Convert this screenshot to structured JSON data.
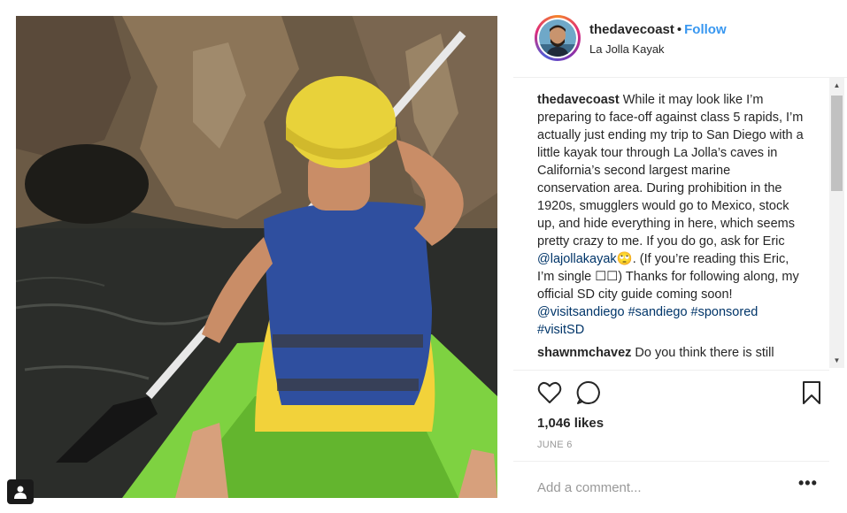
{
  "post": {
    "username": "thedavecoast",
    "separator": "•",
    "follow_label": "Follow",
    "location": "La Jolla Kayak"
  },
  "caption": {
    "username": "thedavecoast",
    "text_part1": "While it may look like I’m preparing to face-off against class 5 rapids, I’m actually just ending my trip to San Diego with a little kayak tour through La Jolla’s caves in California’s second largest marine conservation area. During prohibition in the 1920s, smugglers would go to Mexico, stock up, and hide everything in here, which seems pretty crazy to me. If you do go, ask for Eric",
    "mention_1": "@lajollakayak",
    "text_part2": "🙄. (If you’re reading this Eric, I’m single ☐☐) Thanks for following along, my official SD city guide coming soon!",
    "mention_2": "@visitsandiego",
    "hashtag_1": "#sandiego",
    "hashtag_2": "#sponsored",
    "hashtag_3": "#visitSD"
  },
  "comments": [
    {
      "username": "shawnmchavez",
      "text": "Do you think there is still"
    }
  ],
  "actions": {
    "like_icon": "heart-icon",
    "comment_icon": "speech-bubble-icon",
    "save_icon": "bookmark-icon"
  },
  "likes": "1,046 likes",
  "date": "JUNE 6",
  "add_comment": {
    "placeholder": "Add a comment...",
    "more_label": "•••"
  },
  "colors": {
    "link": "#3897f0",
    "mention": "#003569",
    "muted": "#999999",
    "text": "#262626"
  }
}
